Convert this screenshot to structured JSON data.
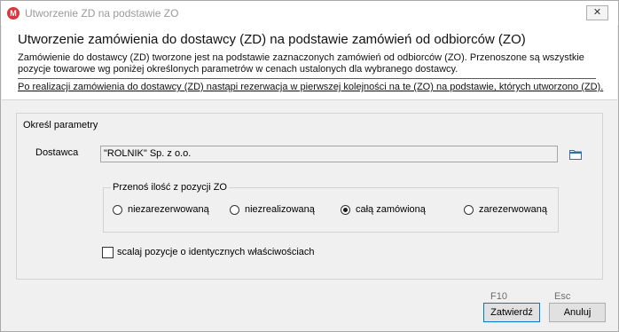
{
  "window": {
    "title": "Utworzenie ZD na podstawie ZO",
    "app_icon_letter": "M",
    "close_glyph": "✕"
  },
  "header": {
    "title": "Utworzenie zamówienia do dostawcy (ZD) na podstawie zamówień od odbiorców (ZO)",
    "description": "Zamówienie do dostawcy (ZD) tworzone jest na podstawie zaznaczonych zamówień od odbiorców (ZO). Przenoszone są wszystkie pozycje towarowe wg poniżej określonych parametrów w cenach ustalonych dla wybranego dostawcy.",
    "note": "Po realizacji zamówienia do dostawcy (ZD) nastąpi rezerwacja w pierwszej kolejności na te (ZO) na podstawie, których utworzono (ZD)."
  },
  "params": {
    "legend": "Określ parametry",
    "supplier_label": "Dostawca",
    "supplier_value": "\"ROLNIK\" Sp. z o.o.",
    "browse_icon": "folder-icon",
    "quantity_group": {
      "legend": "Przenoś ilość z pozycji ZO",
      "options": [
        {
          "label": "niezarezerwowaną",
          "checked": false
        },
        {
          "label": "niezrealizowaną",
          "checked": false
        },
        {
          "label": "całą zamówioną",
          "checked": true
        },
        {
          "label": "zarezerwowaną",
          "checked": false
        }
      ]
    },
    "merge_checkbox": {
      "label": "scalaj pozycje o identycznych właściwościach",
      "checked": false
    }
  },
  "footer": {
    "confirm": {
      "shortcut": "F10",
      "label": "Zatwierdź"
    },
    "cancel": {
      "shortcut": "Esc",
      "label": "Anuluj"
    }
  },
  "colors": {
    "app_icon": "#d9363e",
    "default_button_border": "#0078d7"
  }
}
